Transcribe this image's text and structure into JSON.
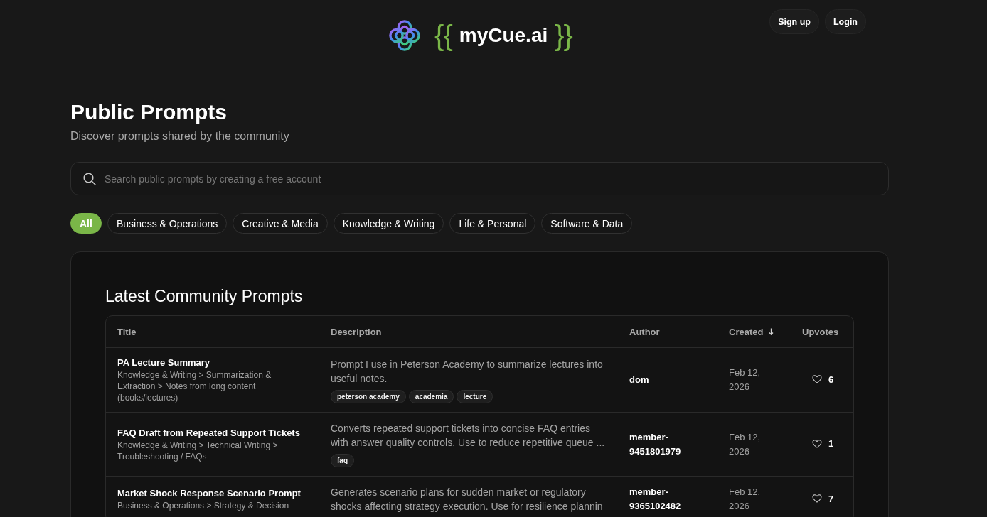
{
  "header": {
    "brand": {
      "open": "{{",
      "name": "myCue.ai",
      "close": "}}"
    },
    "buttons": [
      "Sign up",
      "Login"
    ]
  },
  "page": {
    "title": "Public Prompts",
    "subtitle": "Discover prompts shared by the community"
  },
  "search": {
    "placeholder": "Search public prompts by creating a free account"
  },
  "filters": [
    {
      "label": "All",
      "selected": true
    },
    {
      "label": "Business & Operations",
      "selected": false
    },
    {
      "label": "Creative & Media",
      "selected": false
    },
    {
      "label": "Knowledge & Writing",
      "selected": false
    },
    {
      "label": "Life & Personal",
      "selected": false
    },
    {
      "label": "Software & Data",
      "selected": false
    }
  ],
  "section": {
    "title": "Latest Community Prompts",
    "table": {
      "columns": [
        {
          "label": "Title",
          "sorted": false
        },
        {
          "label": "Description",
          "sorted": false
        },
        {
          "label": "Author",
          "sorted": false
        },
        {
          "label": "Created",
          "sorted": true
        },
        {
          "label": "Upvotes",
          "sorted": false
        }
      ],
      "rows": [
        {
          "title": "PA Lecture Summary",
          "category": "Knowledge & Writing > Summarization & Extraction > Notes from long content (books/lectures)",
          "description": "Prompt I use in Peterson Academy to summarize lectures into useful notes.",
          "tags": [
            "peterson academy",
            "academia",
            "lecture"
          ],
          "author": "dom",
          "created": "Feb 12, 2026",
          "upvotes": "6"
        },
        {
          "title": "FAQ Draft from Repeated Support Tickets",
          "category": "Knowledge & Writing > Technical Writing > Troubleshooting / FAQs",
          "description": "Converts repeated support tickets into concise FAQ entries with answer quality controls. Use to reduce repetitive queue ...",
          "tags": [
            "faq"
          ],
          "author": "member-9451801979",
          "created": "Feb 12, 2026",
          "upvotes": "1"
        },
        {
          "title": "Market Shock Response Scenario Prompt",
          "category": "Business & Operations > Strategy & Decision",
          "description": "Generates scenario plans for sudden market or regulatory shocks affecting strategy execution. Use for resilience plannin",
          "author": "member-9365102482",
          "created": "Feb 12, 2026",
          "upvotes": "7"
        }
      ]
    }
  }
}
